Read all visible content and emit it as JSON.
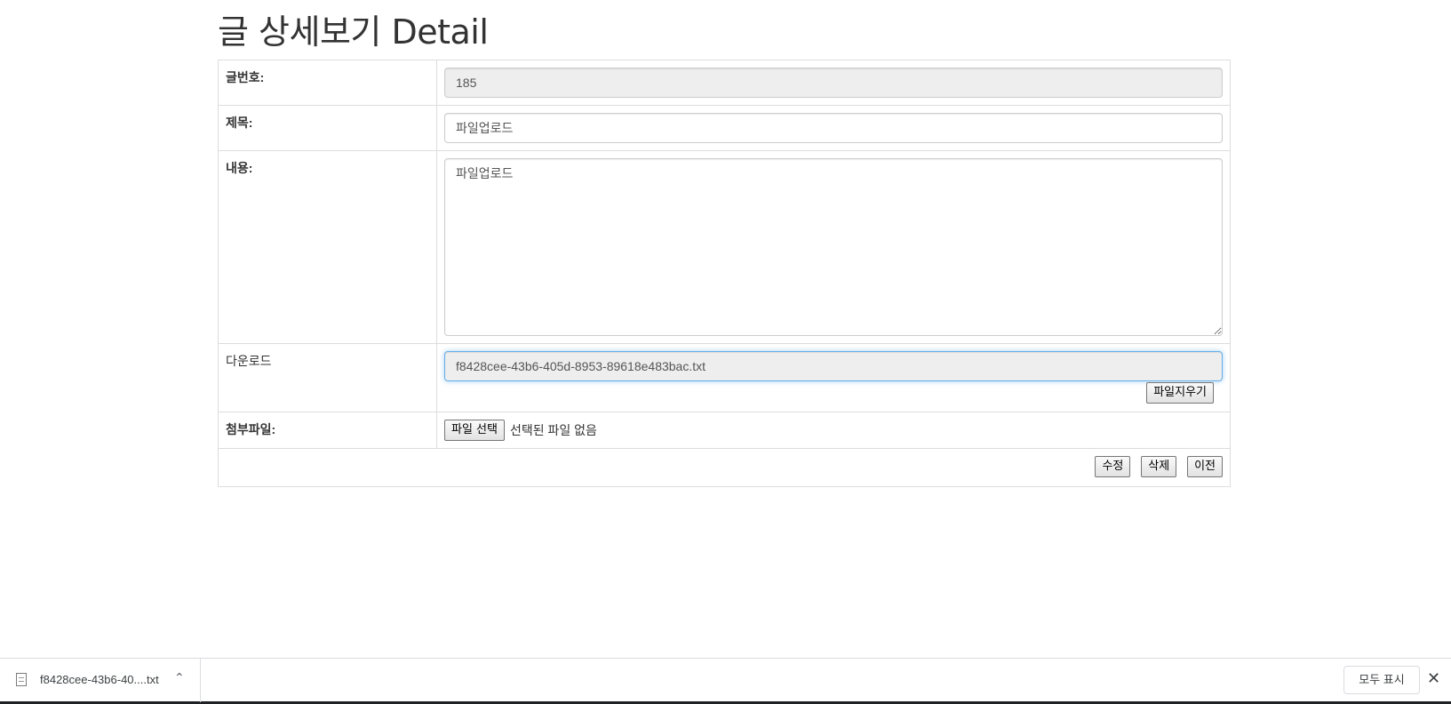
{
  "page": {
    "title": "글 상세보기 Detail"
  },
  "form": {
    "number": {
      "label": "글번호:",
      "value": "185"
    },
    "subject": {
      "label": "제목:",
      "value": "파일업로드"
    },
    "content": {
      "label": "내용:",
      "value": "파일업로드"
    },
    "download": {
      "label": "다운로드",
      "value": "f8428cee-43b6-405d-8953-89618e483bac.txt",
      "delete_button": "파일지우기"
    },
    "attachment": {
      "label": "첨부파일:",
      "choose_button": "파일 선택",
      "status": "선택된 파일 없음"
    },
    "actions": {
      "edit": "수정",
      "delete": "삭제",
      "back": "이전"
    }
  },
  "download_bar": {
    "file_name": "f8428cee-43b6-40....txt",
    "show_all": "모두 표시",
    "icons": {
      "file": "file-icon",
      "chevron": "chevron-up-icon",
      "close": "close-icon"
    }
  },
  "colors": {
    "focus_border": "#66afe9",
    "readonly_bg": "#eeeeee",
    "table_border": "#dddddd"
  }
}
